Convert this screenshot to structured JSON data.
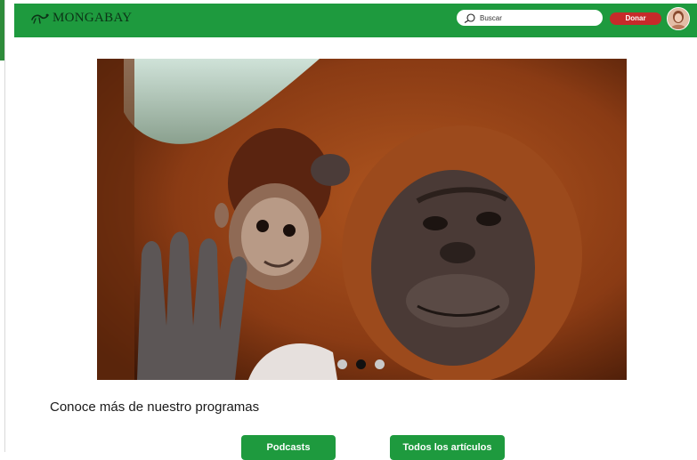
{
  "header": {
    "logo_text": "MONGABAY",
    "search": {
      "placeholder": "Buscar",
      "value": ""
    },
    "donate_label": "Donar"
  },
  "hero": {
    "carousel": {
      "slide_count": 3,
      "active_index": 1
    }
  },
  "section": {
    "title": "Conoce más de nuestro programas"
  },
  "buttons": {
    "podcasts_label": "Podcasts",
    "articles_label": "Todos los artículos"
  },
  "colors": {
    "brand_green": "#1e9a3e",
    "donate_red": "#c62a2a",
    "dot_active": "#111111",
    "dot_inactive": "#c9c9c9"
  },
  "icons": [
    "lizard-logo-icon",
    "search-icon",
    "avatar-icon"
  ]
}
